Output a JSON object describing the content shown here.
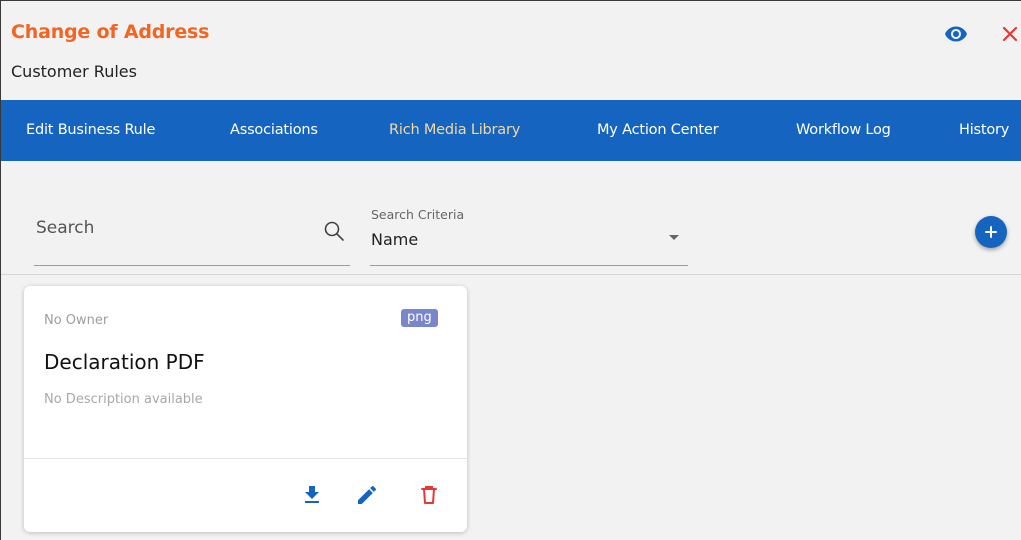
{
  "header": {
    "title": "Change of Address",
    "subtitle": "Customer Rules",
    "icons": [
      "eye-icon",
      "close-icon"
    ]
  },
  "tabs": [
    {
      "label": "Edit Business Rule",
      "active": false
    },
    {
      "label": "Associations",
      "active": false
    },
    {
      "label": "Rich Media Library",
      "active": true
    },
    {
      "label": "My Action Center",
      "active": false
    },
    {
      "label": "Workflow Log",
      "active": false
    },
    {
      "label": "History",
      "active": false
    }
  ],
  "search": {
    "placeholder": "Search",
    "criteria_label": "Search Criteria",
    "criteria_value": "Name"
  },
  "cards": [
    {
      "owner": "No Owner",
      "file_type": "png",
      "title": "Declaration PDF",
      "description": "No Description available",
      "actions": [
        "download-icon",
        "edit-icon",
        "delete-icon"
      ]
    }
  ],
  "colors": {
    "title": "#f26522",
    "tab_bar": "#1565c0",
    "active_tab": "#f7d7a0",
    "primary_icon": "#1565c0",
    "delete_icon": "#e53935",
    "badge": "#7986cb"
  }
}
